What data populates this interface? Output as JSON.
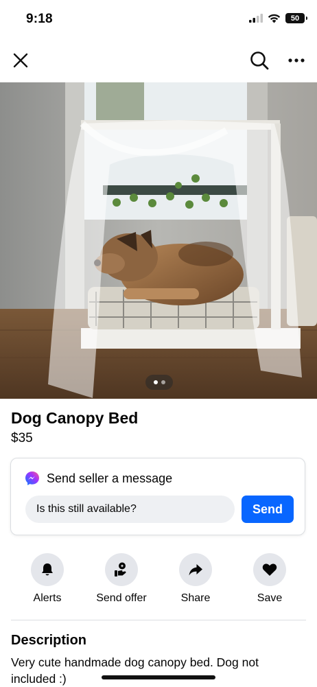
{
  "status_bar": {
    "time": "9:18",
    "battery": "50",
    "icons": [
      "signal-icon",
      "wifi-icon",
      "battery-icon"
    ]
  },
  "nav": {
    "close_icon": "close-icon",
    "search_icon": "search-icon",
    "more_icon": "more-options-icon"
  },
  "gallery": {
    "photo_count": 2,
    "active_index": 0
  },
  "listing": {
    "title": "Dog Canopy Bed",
    "price": "$35"
  },
  "message": {
    "heading": "Send seller a message",
    "input_value": "Is this still available?",
    "send_label": "Send",
    "icon": "messenger-icon"
  },
  "actions": [
    {
      "label": "Alerts",
      "icon": "bell-icon"
    },
    {
      "label": "Send offer",
      "icon": "offer-icon"
    },
    {
      "label": "Share",
      "icon": "share-arrow-icon"
    },
    {
      "label": "Save",
      "icon": "heart-icon"
    }
  ],
  "description": {
    "heading": "Description",
    "text": "Very cute handmade dog canopy bed. Dog not included :)"
  },
  "colors": {
    "accent": "#0866ff",
    "action_circle": "#e4e6eb",
    "text": "#050505"
  }
}
